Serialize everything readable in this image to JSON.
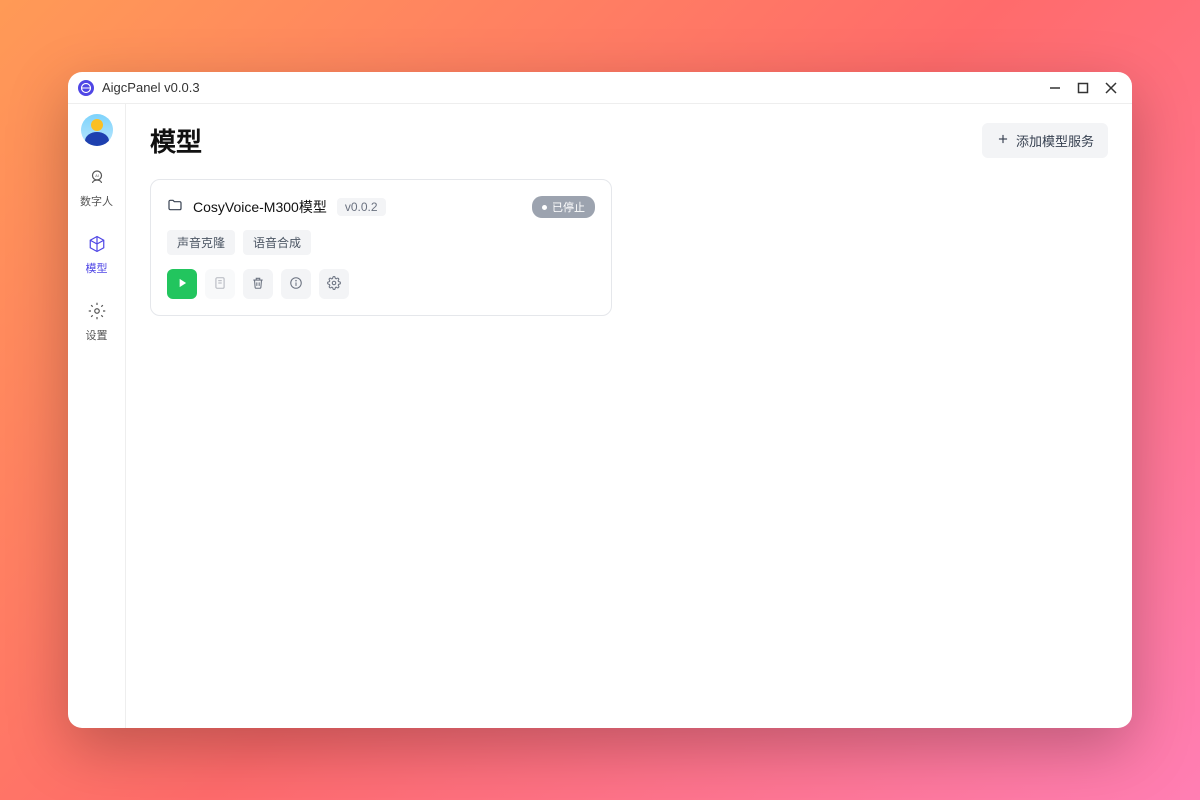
{
  "titlebar": {
    "title": "AigcPanel v0.0.3"
  },
  "sidebar": {
    "items": [
      {
        "label": "数字人",
        "icon": "ai-head-icon"
      },
      {
        "label": "模型",
        "icon": "cube-icon"
      },
      {
        "label": "设置",
        "icon": "gear-icon"
      }
    ]
  },
  "page": {
    "title": "模型",
    "add_button": "添加模型服务"
  },
  "model_card": {
    "name": "CosyVoice-M300模型",
    "version": "v0.0.2",
    "status": "已停止",
    "tags": [
      "声音克隆",
      "语音合成"
    ]
  }
}
